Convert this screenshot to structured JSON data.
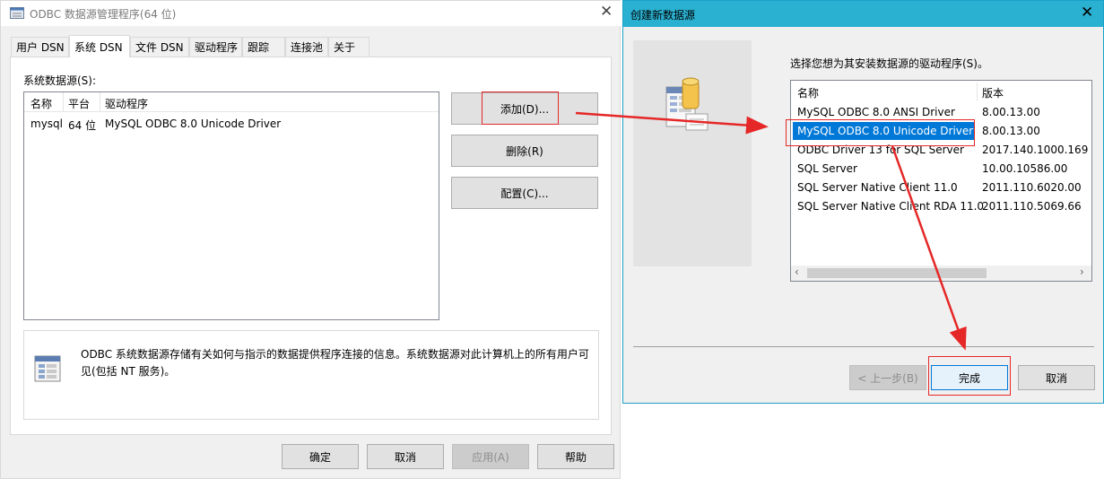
{
  "win1": {
    "title": "ODBC 数据源管理程序(64 位)",
    "tabs": [
      "用户 DSN",
      "系统 DSN",
      "文件 DSN",
      "驱动程序",
      "跟踪",
      "连接池",
      "关于"
    ],
    "group_label": "系统数据源(S):",
    "columns": [
      "名称",
      "平台",
      "驱动程序"
    ],
    "rows": [
      {
        "name": "mysql",
        "platform": "64 位",
        "driver": "MySQL ODBC 8.0 Unicode Driver"
      }
    ],
    "buttons": {
      "add": "添加(D)...",
      "remove": "删除(R)",
      "configure": "配置(C)..."
    },
    "info_text": "ODBC 系统数据源存储有关如何与指示的数据提供程序连接的信息。系统数据源对此计算机上的所有用户可见(包括 NT 服务)。",
    "footer": {
      "ok": "确定",
      "cancel": "取消",
      "apply": "应用(A)",
      "help": "帮助"
    }
  },
  "win2": {
    "title": "创建新数据源",
    "prompt": "选择您想为其安装数据源的驱动程序(S)。",
    "columns": [
      "名称",
      "版本"
    ],
    "drivers": [
      {
        "name": "MySQL ODBC 8.0 ANSI Driver",
        "version": "8.00.13.00"
      },
      {
        "name": "MySQL ODBC 8.0 Unicode Driver",
        "version": "8.00.13.00"
      },
      {
        "name": "ODBC Driver 13 for SQL Server",
        "version": "2017.140.1000.169"
      },
      {
        "name": "SQL Server",
        "version": "10.00.10586.00"
      },
      {
        "name": "SQL Server Native Client 11.0",
        "version": "2011.110.6020.00"
      },
      {
        "name": "SQL Server Native Client RDA 11.0",
        "version": "2011.110.5069.66"
      }
    ],
    "selected_index": 1,
    "buttons": {
      "back": "< 上一步(B)",
      "finish": "完成",
      "cancel": "取消"
    }
  },
  "colors": {
    "selection": "#0078d7",
    "accent_titlebar": "#2ab0d0",
    "annotation_red": "#e52727"
  }
}
